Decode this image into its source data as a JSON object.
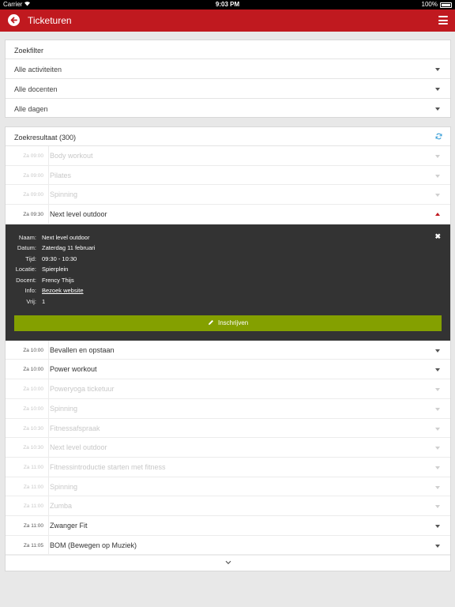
{
  "status_bar": {
    "carrier": "Carrier",
    "time": "9:03 PM",
    "battery": "100%"
  },
  "app_bar": {
    "title": "Ticketuren"
  },
  "filter": {
    "title": "Zoekfilter",
    "activities": "Alle activiteiten",
    "teachers": "Alle docenten",
    "days": "Alle dagen"
  },
  "results": {
    "title": "Zoekresultaat (300)",
    "rows_before": [
      {
        "time": "Za 09:00",
        "name": "Body workout",
        "dim": true
      },
      {
        "time": "Za 09:00",
        "name": "Pilates",
        "dim": true
      },
      {
        "time": "Za 09:00",
        "name": "Spinning",
        "dim": true
      }
    ],
    "expanded_row": {
      "time": "Za 09:30",
      "name": "Next level outdoor"
    },
    "detail": {
      "labels": {
        "name": "Naam:",
        "date": "Datum:",
        "time": "Tijd:",
        "location": "Locatie:",
        "teacher": "Docent:",
        "info": "Info:",
        "free": "Vrij:"
      },
      "values": {
        "name": "Next level outdoor",
        "date": "Zaterdag 11 februari",
        "time": "09:30 - 10:30",
        "location": "Spierplein",
        "teacher": "Frency Thijs",
        "info": "Bezoek website",
        "free": "1"
      },
      "button": "Inschrijven"
    },
    "rows_after": [
      {
        "time": "Za 10:00",
        "name": "Bevallen en opstaan",
        "dim": false
      },
      {
        "time": "Za 10:00",
        "name": "Power workout",
        "dim": false
      },
      {
        "time": "Za 10:00",
        "name": "Poweryoga ticketuur",
        "dim": true
      },
      {
        "time": "Za 10:00",
        "name": "Spinning",
        "dim": true
      },
      {
        "time": "Za 10:30",
        "name": "Fitnessafspraak",
        "dim": true
      },
      {
        "time": "Za 10:30",
        "name": "Next level outdoor",
        "dim": true
      },
      {
        "time": "Za 11:00",
        "name": "Fitnessintroductie starten met fitness",
        "dim": true
      },
      {
        "time": "Za 11:00",
        "name": "Spinning",
        "dim": true
      },
      {
        "time": "Za 11:00",
        "name": "Zumba",
        "dim": true
      },
      {
        "time": "Za 11:00",
        "name": "Zwanger Fit",
        "dim": false
      },
      {
        "time": "Za 11:05",
        "name": "BOM (Bewegen op Muziek)",
        "dim": false
      }
    ]
  },
  "colors": {
    "brand": "#c0191f",
    "button": "#84a000",
    "detail_bg": "#333333"
  }
}
